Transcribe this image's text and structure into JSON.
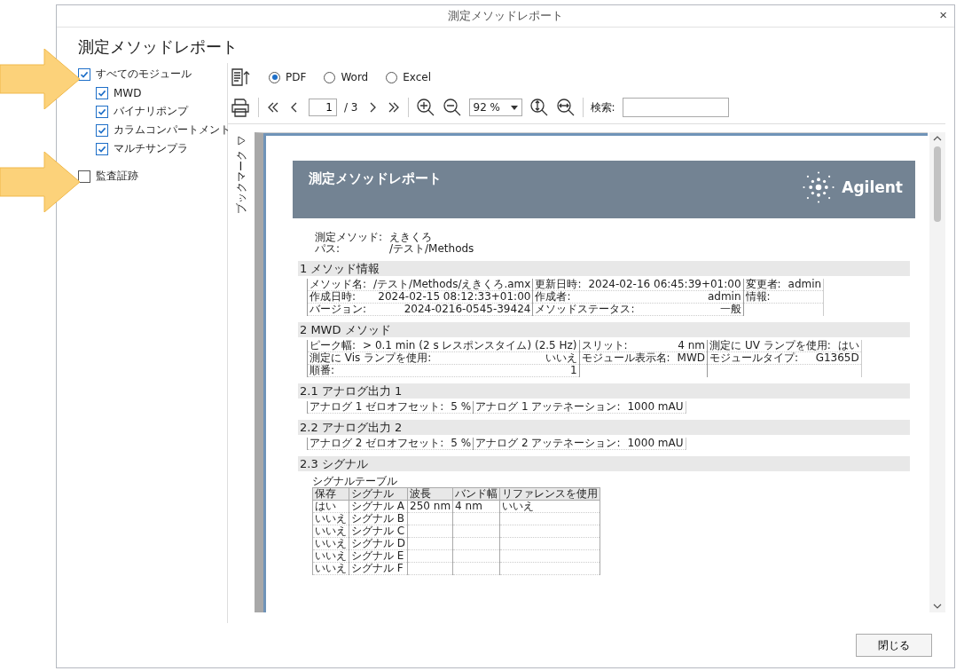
{
  "window": {
    "title": "測定メソッドレポート",
    "close": "×"
  },
  "heading": "測定メソッドレポート",
  "modules": {
    "label": "すべてのモジュール",
    "checked": true,
    "children": [
      {
        "label": "MWD",
        "checked": true
      },
      {
        "label": "バイナリポンプ",
        "checked": true
      },
      {
        "label": "カラムコンパートメント",
        "checked": true
      },
      {
        "label": "マルチサンプラ",
        "checked": true
      }
    ]
  },
  "audit_trail": {
    "label": "監査証跡",
    "checked": false
  },
  "formats": [
    {
      "label": "PDF",
      "selected": true
    },
    {
      "label": "Word",
      "selected": false
    },
    {
      "label": "Excel",
      "selected": false
    }
  ],
  "pager": {
    "page": "1",
    "total": "/ 3"
  },
  "zoom": "92 %",
  "search": {
    "label": "検索:"
  },
  "bookmarks": {
    "label": "ブックマーク"
  },
  "document": {
    "title": "測定メソッドレポート",
    "logo": "Agilent",
    "meta": [
      {
        "label": "測定メソッド:",
        "value": "えきくろ"
      },
      {
        "label": "パス:",
        "value": "/テスト/Methods"
      }
    ],
    "sections": [
      {
        "title": "1 メソッド情報",
        "kind": "grid",
        "columns": [
          [
            {
              "label": "メソッド名:",
              "value": "/テスト/Methods/えきくろ.amx"
            },
            {
              "label": "作成日時:",
              "value": "2024-02-15 08:12:33+01:00"
            },
            {
              "label": "バージョン:",
              "value": "2024-0216-0545-39424"
            }
          ],
          [
            {
              "label": "更新日時:",
              "value": "2024-02-16 06:45:39+01:00"
            },
            {
              "label": "作成者:",
              "value": "admin"
            },
            {
              "label": "メソッドステータス:",
              "value": "一般"
            }
          ],
          [
            {
              "label": "変更者:",
              "value": "admin"
            },
            {
              "label": "情報:"
            }
          ]
        ]
      },
      {
        "title": "2 MWD メソッド",
        "kind": "grid",
        "columns": [
          [
            {
              "label": "ピーク幅:",
              "value": "> 0.1 min (2 s レスポンスタイム) (2.5 Hz)"
            },
            {
              "label": "測定に Vis ランプを使用:",
              "value": "いいえ"
            },
            {
              "label": "順番:",
              "value": "1"
            }
          ],
          [
            {
              "label": "スリット:",
              "value": "4 nm"
            },
            {
              "label": "モジュール表示名:",
              "value": "MWD"
            }
          ],
          [
            {
              "label": "測定に UV ランプを使用:",
              "value": "はい"
            },
            {
              "label": "モジュールタイプ:",
              "value": "G1365D"
            }
          ]
        ]
      },
      {
        "title": "2.1 アナログ出力 1",
        "kind": "grid",
        "columns": [
          [
            {
              "label": "アナログ 1 ゼロオフセット:",
              "value": "5 %"
            }
          ],
          [
            {
              "label": "アナログ 1 アッテネーション:",
              "value": "1000 mAU"
            }
          ]
        ]
      },
      {
        "title": "2.2 アナログ出力 2",
        "kind": "grid",
        "columns": [
          [
            {
              "label": "アナログ 2 ゼロオフセット:",
              "value": "5 %"
            }
          ],
          [
            {
              "label": "アナログ 2 アッテネーション:",
              "value": "1000 mAU"
            }
          ]
        ]
      },
      {
        "title": "2.3 シグナル",
        "kind": "table",
        "caption": "シグナルテーブル",
        "columns": [
          "保存",
          "シグナル",
          "波長",
          "バンド幅",
          "リファレンスを使用"
        ],
        "rows": [
          [
            "はい",
            "シグナル A",
            "250 nm",
            "4 nm",
            "いいえ"
          ],
          [
            "いいえ",
            "シグナル B"
          ],
          [
            "いいえ",
            "シグナル C"
          ],
          [
            "いいえ",
            "シグナル D"
          ],
          [
            "いいえ",
            "シグナル E"
          ],
          [
            "いいえ",
            "シグナル F"
          ]
        ]
      }
    ]
  },
  "close_button": "閉じる"
}
